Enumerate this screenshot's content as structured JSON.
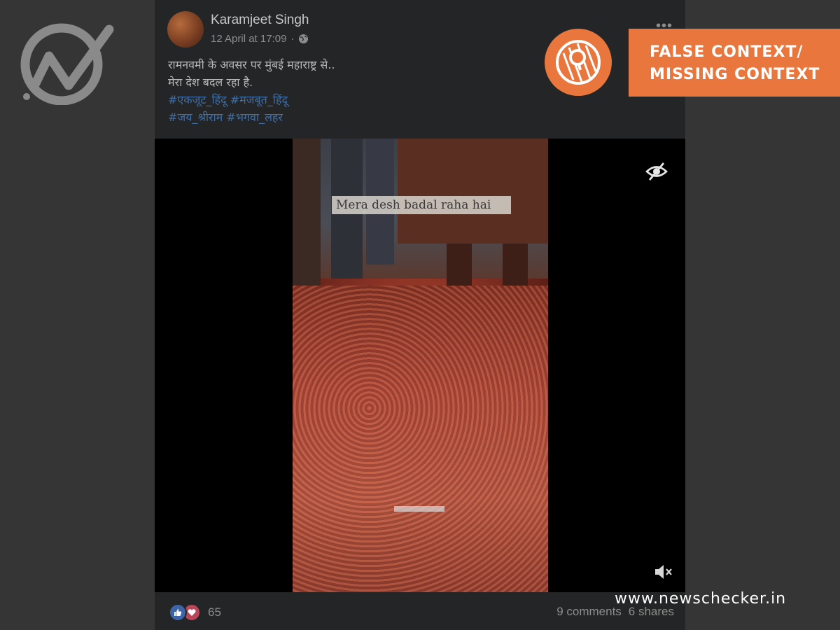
{
  "post": {
    "author": "Karamjeet Singh",
    "timestamp": "12 April at 17:09",
    "text_line1": "रामनवमी के अवसर पर मुंबई महाराष्ट्र से..",
    "text_line2": "मेरा देश बदल रहा है.",
    "hashtags_line1": "#एकजूट_हिंदू #मजबूत_हिंदू",
    "hashtags_line2": "#जय_श्रीराम #भगवा_लहर",
    "more_label": "•••"
  },
  "video": {
    "overlay_caption": "Mera desh badal raha hai"
  },
  "footer": {
    "reaction_count": "65",
    "comments": "9 comments",
    "shares": "6 shares"
  },
  "verdict": {
    "line1": "FALSE CONTEXT/",
    "line2": "MISSING CONTEXT",
    "color": "#e8763d"
  },
  "watermark": "www.newschecker.in",
  "icons": {
    "logo": "newschecker-logo-icon",
    "globe": "globe-icon",
    "eye_off": "eye-off-icon",
    "mute": "mute-icon",
    "like": "like-icon",
    "love": "love-icon",
    "verdict": "magnifier-badge-icon"
  }
}
